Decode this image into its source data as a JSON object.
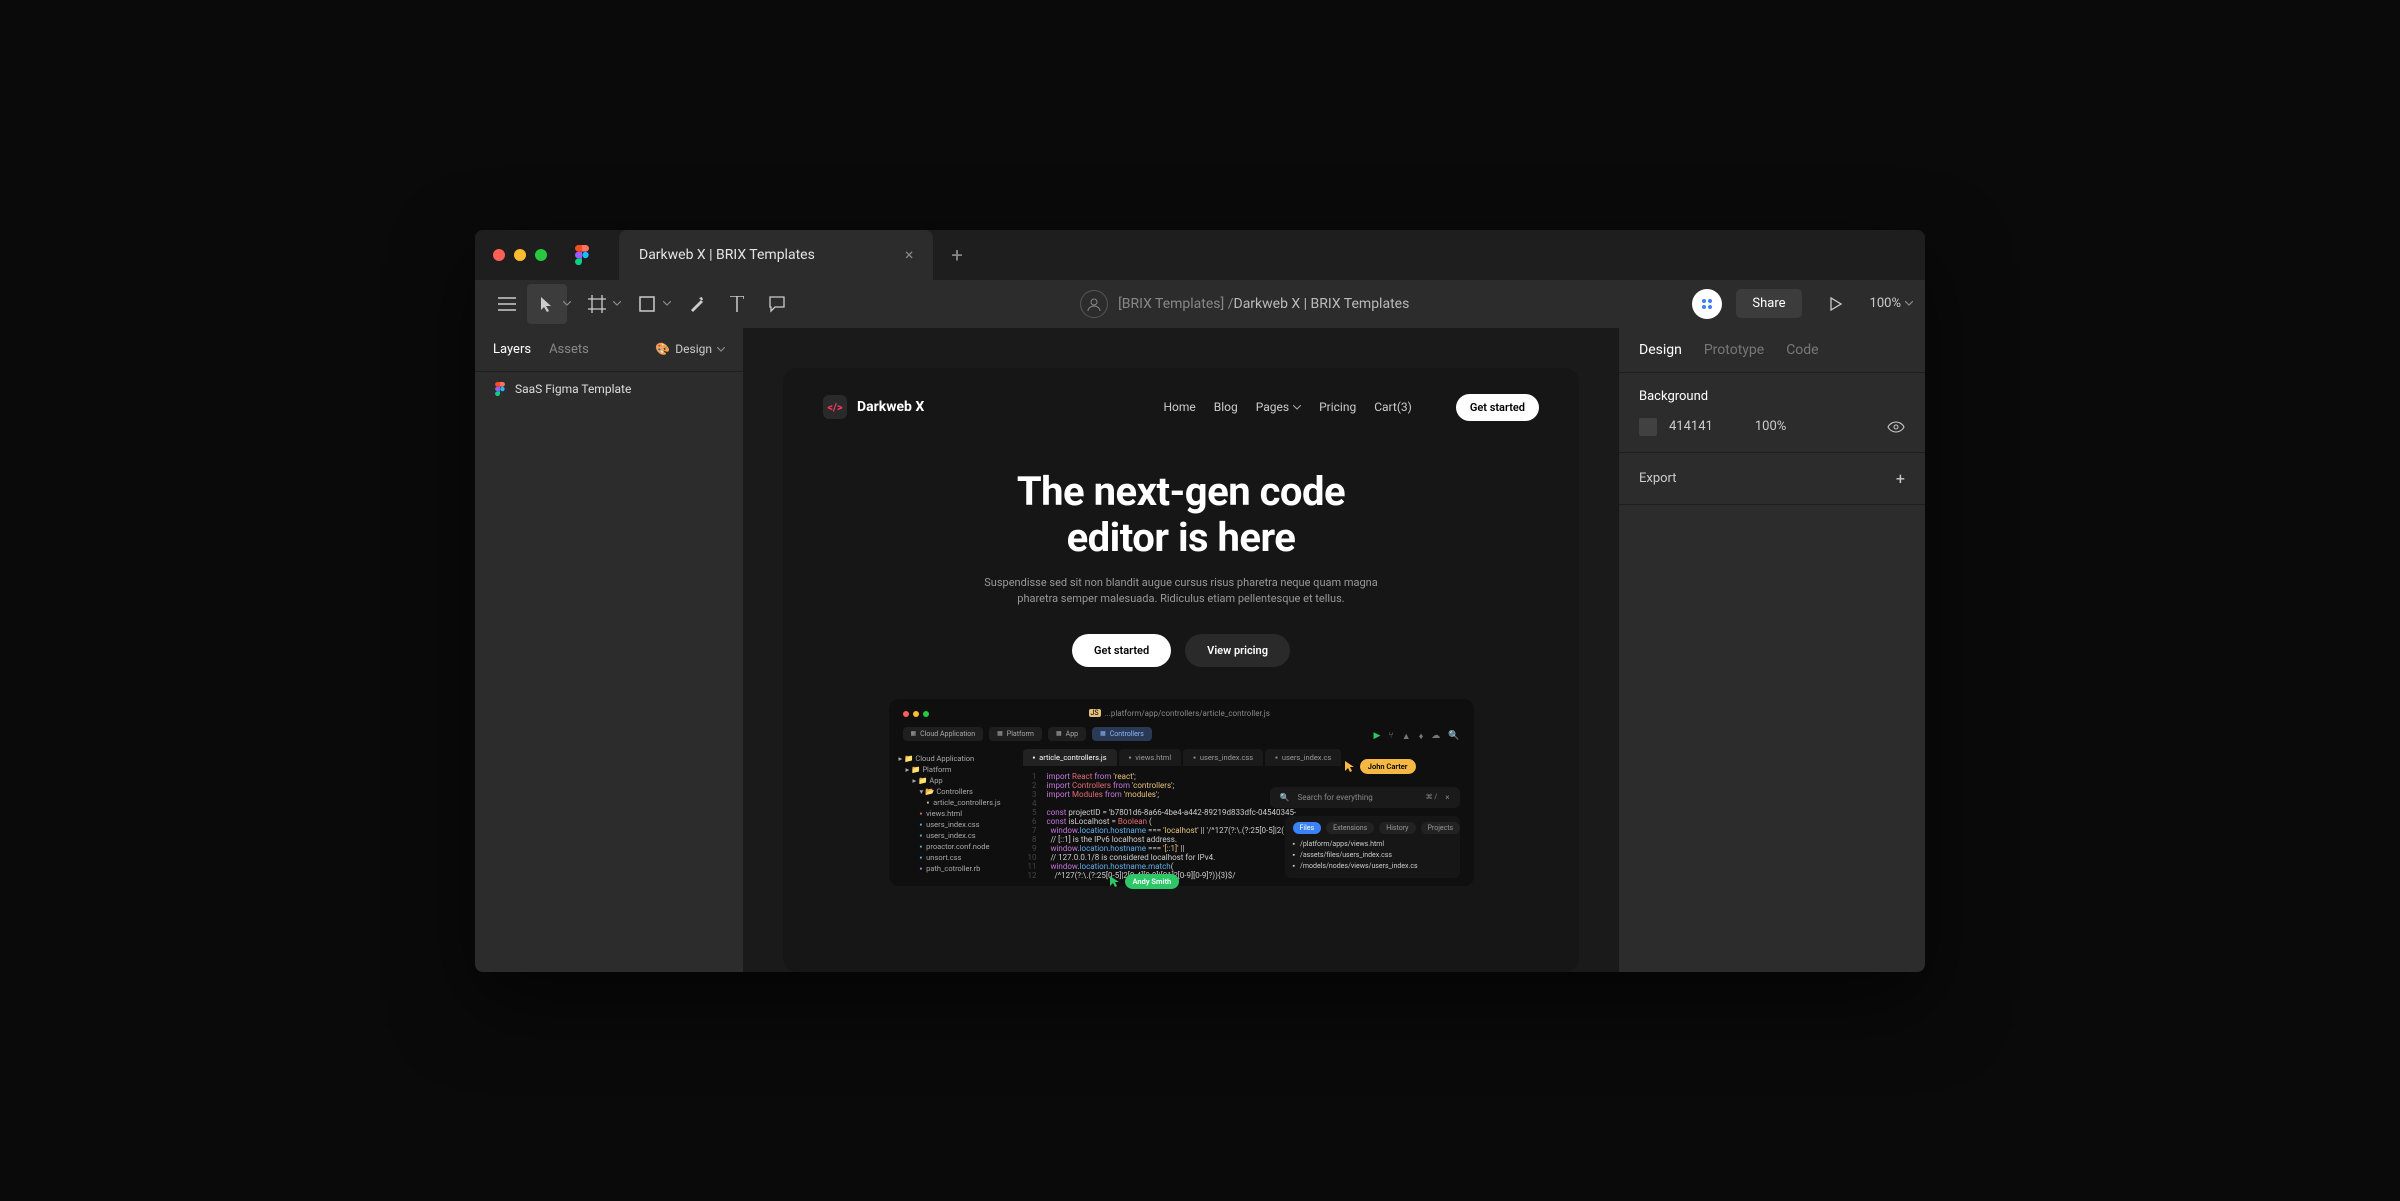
{
  "tab": {
    "title": "Darkweb X | BRIX Templates"
  },
  "breadcrumb": {
    "prefix": "[BRIX Templates] /",
    "title": "Darkweb X | BRIX Templates"
  },
  "toolbar": {
    "share": "Share",
    "zoom": "100%"
  },
  "leftPanel": {
    "tabs": {
      "layers": "Layers",
      "assets": "Assets"
    },
    "pagePicker": "Design",
    "layer": "SaaS Figma Template"
  },
  "rightPanel": {
    "tabs": {
      "design": "Design",
      "prototype": "Prototype",
      "code": "Code"
    },
    "background": {
      "title": "Background",
      "hex": "414141",
      "opacity": "100%"
    },
    "export": "Export"
  },
  "site": {
    "brand": "Darkweb X",
    "nav": {
      "home": "Home",
      "blog": "Blog",
      "pages": "Pages",
      "pricing": "Pricing",
      "cart": "Cart(3)",
      "cta": "Get started"
    },
    "hero": {
      "title1": "The next-gen code",
      "title2": "editor is here",
      "sub": "Suspendisse sed sit non blandit augue cursus risus pharetra neque quam magna pharetra semper malesuada. Ridiculus etiam pellentesque et tellus.",
      "btn1": "Get started",
      "btn2": "View pricing"
    },
    "editor": {
      "filepath": "...platform/app/controllers/article_controller.js",
      "crumbs": [
        "Cloud Application",
        "Platform",
        "App",
        "Controllers"
      ],
      "toolIcons": [
        "play",
        "branch",
        "warn",
        "flame",
        "download",
        "search"
      ],
      "tree": [
        {
          "l": "Cloud Application",
          "i": 0,
          "t": "folder"
        },
        {
          "l": "Platform",
          "i": 1,
          "t": "folder"
        },
        {
          "l": "App",
          "i": 2,
          "t": "folder"
        },
        {
          "l": "Controllers",
          "i": 3,
          "t": "folder-open"
        },
        {
          "l": "article_controllers.js",
          "i": 4,
          "t": "js"
        },
        {
          "l": "views.html",
          "i": 3,
          "t": "html"
        },
        {
          "l": "users_index.css",
          "i": 3,
          "t": "css"
        },
        {
          "l": "users_index.cs",
          "i": 3,
          "t": "cs"
        },
        {
          "l": "proactor.conf.node",
          "i": 3,
          "t": "cs"
        },
        {
          "l": "unsort.css",
          "i": 3,
          "t": "css"
        },
        {
          "l": "path_cotroller.rb",
          "i": 3,
          "t": "rb"
        }
      ],
      "filetabs": [
        {
          "l": "article_controllers.js",
          "c": "js",
          "active": true
        },
        {
          "l": "views.html",
          "c": "html"
        },
        {
          "l": "users_index.css",
          "c": "css"
        },
        {
          "l": "users_index.cs",
          "c": "cs"
        }
      ],
      "lines": [
        "import React from 'react';",
        "import Controllers from 'controllers';",
        "import Modules from 'modules';",
        "",
        "const projectID = 'b7801d6-8a66-4be4-a442-89219d833dfc-04540345-",
        "const isLocalhost = Boolean (",
        "  window.location.hostname === 'localhost' || '/^127(?:\\.(?:25[0-5]|2(",
        "  // [::1] is the IPv6 localhost address.",
        "  window.location.hostname === '[::1]' ||",
        "  // 127.0.0.1/8 is considered localhost for IPv4.",
        "  window.location.hostname.match(",
        "    /^127(?:\\.(?:25[0-5]|2[0-4][0-9]|[01]?[0-9][0-9]?)){3}$/"
      ],
      "cursor1": "John Carter",
      "cursor2": "Andy Smith",
      "search": {
        "placeholder": "Search for everything",
        "shortcut": "⌘ /"
      },
      "bottom": {
        "tabs": [
          "Files",
          "Extensions",
          "History",
          "Projects"
        ],
        "rows": [
          {
            "l": "/platform/apps/views.html",
            "c": "html"
          },
          {
            "l": "/assets/files/users_index.css",
            "c": "css"
          },
          {
            "l": "/models/nodes/views/users_index.cs",
            "c": "cs"
          }
        ]
      }
    }
  }
}
